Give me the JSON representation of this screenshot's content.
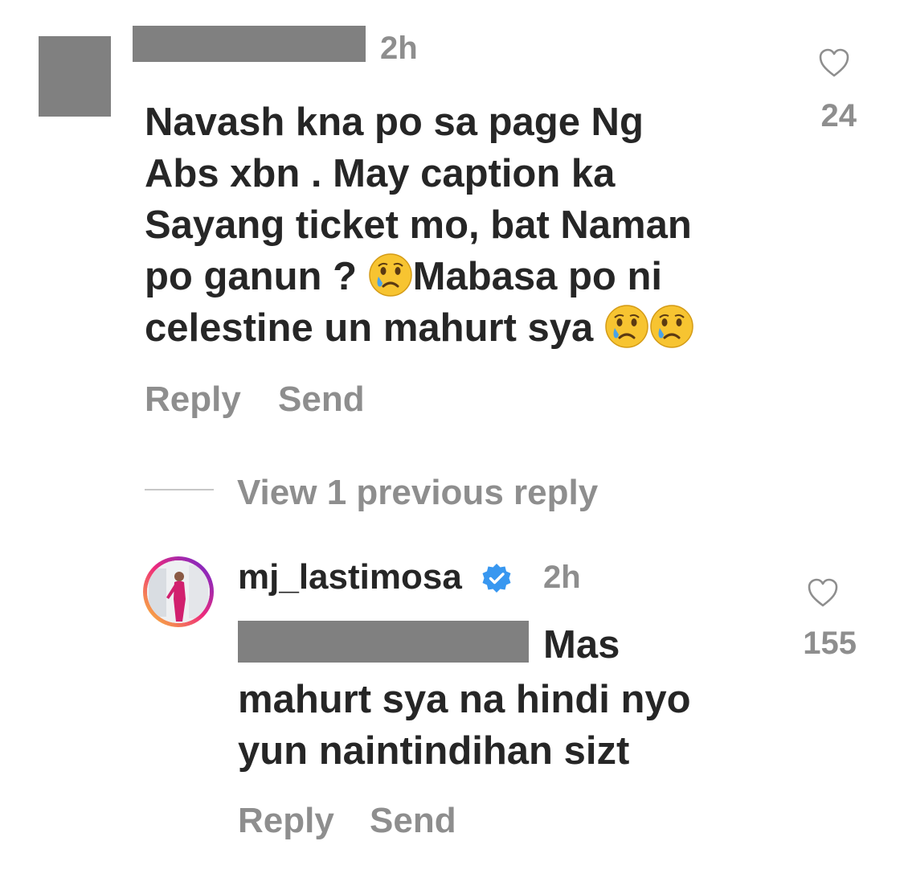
{
  "comment": {
    "timestamp": "2h",
    "text": "Navash kna po sa page Ng\nAbs xbn . May caption ka\nSayang ticket mo, bat Naman\npo ganun ? ",
    "text_after_emoji": "Mabasa po ni",
    "text_last_line": "celestine un mahurt sya ",
    "likes": "24",
    "reply_label": "Reply",
    "send_label": "Send"
  },
  "view_replies": {
    "label": "View 1 previous reply"
  },
  "reply": {
    "username": "mj_lastimosa",
    "verified": true,
    "timestamp": "2h",
    "text_first": "Mas",
    "text_rest_1": "mahurt sya na hindi nyo",
    "text_rest_2": "yun naintindihan sizt",
    "likes": "155",
    "reply_label": "Reply",
    "send_label": "Send"
  },
  "icons": {
    "emoji": "crying-face-emoji",
    "heart": "heart-outline-icon",
    "verified": "verified-badge-icon"
  },
  "colors": {
    "text": "#262626",
    "muted": "#8e8e8e",
    "redaction": "#808080",
    "verified": "#3897f0"
  }
}
